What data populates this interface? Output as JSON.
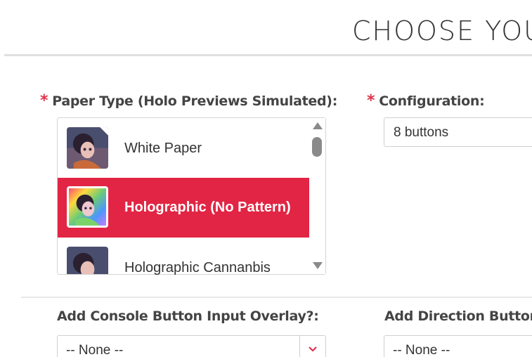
{
  "header": {
    "title": "CHOOSE YOU"
  },
  "paper_type": {
    "required_mark": "*",
    "label": "Paper Type (Holo Previews Simulated):",
    "options": [
      {
        "label": "White Paper",
        "selected": false,
        "icon": "paper-thumbnail-icon"
      },
      {
        "label": "Holographic (No Pattern)",
        "selected": true,
        "icon": "holo-thumbnail-icon"
      },
      {
        "label": "Holographic Cannanbis",
        "selected": false,
        "icon": "holo-cannabis-thumbnail-icon"
      }
    ]
  },
  "configuration": {
    "required_mark": "*",
    "label": "Configuration:",
    "value": "8 buttons"
  },
  "console_overlay": {
    "label": "Add Console Button Input Overlay?:",
    "value": "-- None --",
    "icon": "chevron-down-icon"
  },
  "direction_overlay": {
    "label": "Add Direction Button C",
    "value": "-- None --"
  },
  "colors": {
    "accent": "#e22544",
    "required": "#e2304a",
    "border": "#cfcfcf"
  }
}
